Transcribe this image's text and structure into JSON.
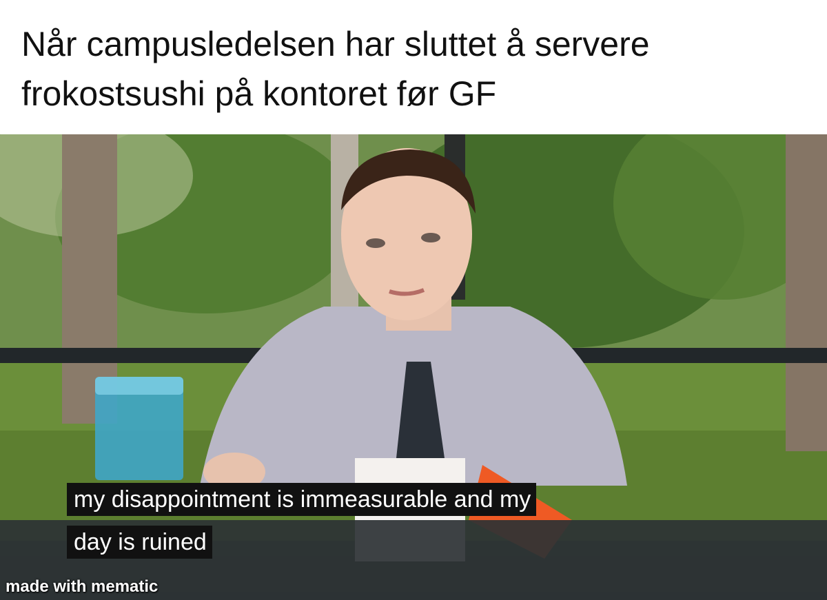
{
  "caption": {
    "line1": "Når campusledelsen har sluttet å servere",
    "line2": "frokostsushi på kontoret før GF"
  },
  "subtitle": {
    "line1": "my disappointment is immeasurable and my",
    "line2": "day is ruined"
  },
  "watermark": "made with mematic"
}
